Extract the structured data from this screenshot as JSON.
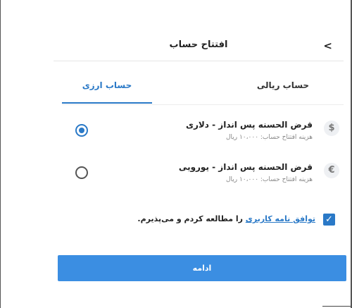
{
  "header": {
    "title": "افتتاح حساب",
    "back_icon": "chevron-left-icon"
  },
  "tabs": [
    {
      "label": "حساب ارزی",
      "active": true
    },
    {
      "label": "حساب ریالی",
      "active": false
    }
  ],
  "options": [
    {
      "icon_text": "$",
      "title": "قرض الحسنه پس انداز - دلاری",
      "subtitle": "هزینه افتتاح حساب: ۱۰،۰۰۰ ریال",
      "selected": true
    },
    {
      "icon_text": "€",
      "title": "قرض الحسنه پس انداز - یورویی",
      "subtitle": "هزینه افتتاح حساب: ۱۰،۰۰۰ ریال",
      "selected": false
    }
  ],
  "agreement": {
    "checked": true,
    "check_glyph": "✓",
    "link_text": "توافق نامه کاربری",
    "rest_text": " را مطالعه کردم و می‌پذیرم."
  },
  "continue_label": "ادامه",
  "colors": {
    "accent": "#2a79c7",
    "button": "#3b8ee2"
  }
}
